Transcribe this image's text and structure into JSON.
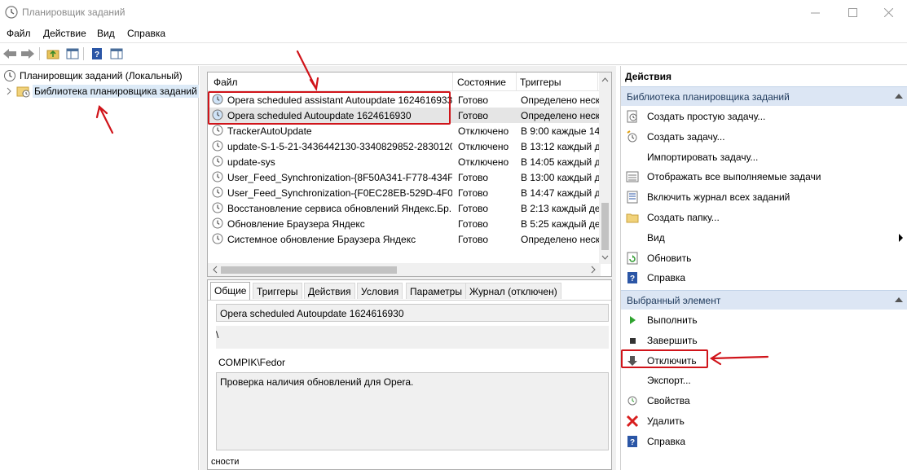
{
  "window": {
    "title": "Планировщик заданий",
    "minimize": "—",
    "maximize": "☐",
    "close": "✕"
  },
  "menu": [
    "Файл",
    "Действие",
    "Вид",
    "Справка"
  ],
  "tree": {
    "root": "Планировщик заданий (Локальный)",
    "library": "Библиотека планировщика заданий"
  },
  "list": {
    "headers": [
      "Файл",
      "Состояние",
      "Триггеры"
    ],
    "rows": [
      {
        "name": "Opera scheduled assistant Autoupdate 1624616933",
        "state": "Готово",
        "trigger": "Определено неск"
      },
      {
        "name": "Opera scheduled Autoupdate 1624616930",
        "state": "Готово",
        "trigger": "Определено неск"
      },
      {
        "name": "TrackerAutoUpdate",
        "state": "Отключено",
        "trigger": "В 9:00 каждые 14 д"
      },
      {
        "name": "update-S-1-5-21-3436442130-3340829852-2830120...",
        "state": "Отключено",
        "trigger": "В 13:12 каждый ден"
      },
      {
        "name": "update-sys",
        "state": "Отключено",
        "trigger": "В 14:05 каждый ден"
      },
      {
        "name": "User_Feed_Synchronization-{8F50A341-F778-434F-...",
        "state": "Готово",
        "trigger": "В 13:00 каждый ден"
      },
      {
        "name": "User_Feed_Synchronization-{F0EC28EB-529D-4F05...",
        "state": "Готово",
        "trigger": "В 14:47 каждый ден"
      },
      {
        "name": "Восстановление сервиса обновлений Яндекс.Бр...",
        "state": "Готово",
        "trigger": "В 2:13 каждый ден"
      },
      {
        "name": "Обновление Браузера Яндекс",
        "state": "Готово",
        "trigger": "В 5:25 каждый ден"
      },
      {
        "name": "Системное обновление Браузера Яндекс",
        "state": "Готово",
        "trigger": "Определено неск"
      }
    ]
  },
  "detail": {
    "tabs": [
      "Общие",
      "Триггеры",
      "Действия",
      "Условия",
      "Параметры",
      "Журнал (отключен)"
    ],
    "name": "Opera scheduled Autoupdate 1624616930",
    "location": "\\",
    "author": "COMPIK\\Fedor",
    "description": "Проверка наличия обновлений для Opera.",
    "cut_label": "сности"
  },
  "actions": {
    "header": "Действия",
    "section1": {
      "title": "Библиотека планировщика заданий",
      "items": [
        {
          "label": "Создать простую задачу...",
          "icon": "simple-task-icon"
        },
        {
          "label": "Создать задачу...",
          "icon": "create-task-icon"
        },
        {
          "label": "Импортировать задачу...",
          "icon": ""
        },
        {
          "label": "Отображать все выполняемые задачи",
          "icon": "running-tasks-icon"
        },
        {
          "label": "Включить журнал всех заданий",
          "icon": "log-icon"
        },
        {
          "label": "Создать папку...",
          "icon": "folder-icon"
        },
        {
          "label": "Вид",
          "icon": ""
        },
        {
          "label": "Обновить",
          "icon": "refresh-icon"
        },
        {
          "label": "Справка",
          "icon": "help-icon"
        }
      ]
    },
    "section2": {
      "title": "Выбранный элемент",
      "items": [
        {
          "label": "Выполнить",
          "icon": "run-icon"
        },
        {
          "label": "Завершить",
          "icon": "stop-icon"
        },
        {
          "label": "Отключить",
          "icon": "disable-icon"
        },
        {
          "label": "Экспорт...",
          "icon": ""
        },
        {
          "label": "Свойства",
          "icon": "properties-icon"
        },
        {
          "label": "Удалить",
          "icon": "delete-icon"
        },
        {
          "label": "Справка",
          "icon": "help-icon"
        }
      ]
    }
  },
  "colors": {
    "highlight": "#d0141a",
    "section_bg": "#dce6f4",
    "selection": "#e5e5e5"
  }
}
